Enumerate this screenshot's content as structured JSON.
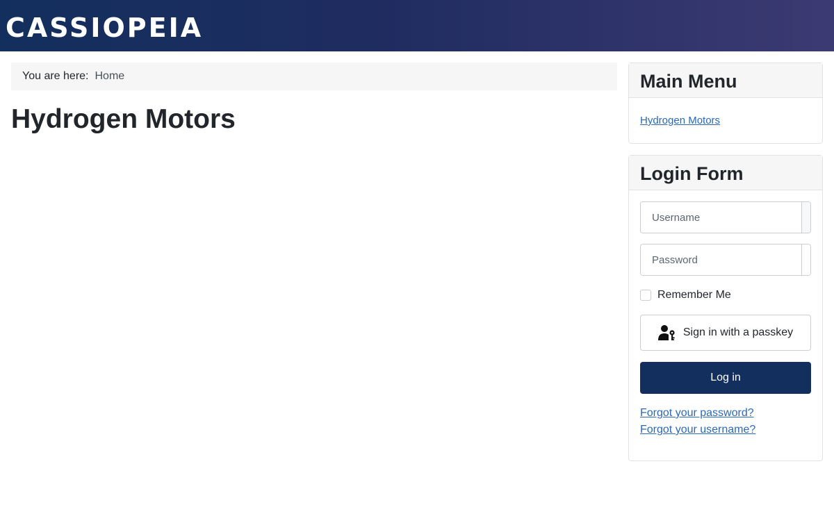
{
  "header": {
    "brand": "CASSIOPEIA"
  },
  "breadcrumb": {
    "prefix": "You are here:",
    "home": "Home"
  },
  "main": {
    "title": "Hydrogen Motors"
  },
  "main_menu": {
    "title": "Main Menu",
    "items": [
      {
        "label": "Hydrogen Motors"
      }
    ]
  },
  "login_form": {
    "title": "Login Form",
    "username_placeholder": "Username",
    "username_value": "",
    "password_placeholder": "Password",
    "password_value": "",
    "remember_label": "Remember Me",
    "remember_checked": false,
    "passkey_label": "Sign in with a passkey",
    "passkey_icon": "user-key-icon",
    "login_label": "Log in",
    "forgot_password": "Forgot your password?",
    "forgot_username": "Forgot your username?"
  },
  "colors": {
    "header_start": "#132f5e",
    "header_end": "#3c3a72",
    "primary_button": "#132f5e",
    "link": "#2a69b8"
  }
}
